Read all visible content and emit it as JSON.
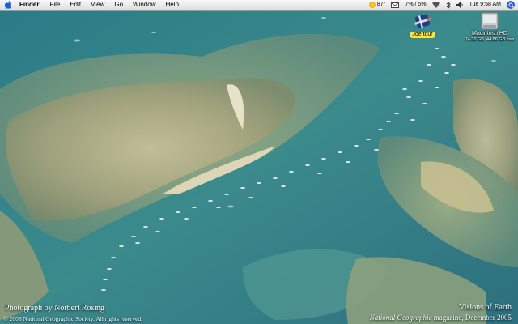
{
  "menubar": {
    "app_name": "Finder",
    "items": [
      "File",
      "Edit",
      "View",
      "Go",
      "Window",
      "Help"
    ],
    "extras": {
      "weather": "87°",
      "battery": "7% / 5%",
      "clock": "Tue 9:58 AM"
    }
  },
  "desktop": {
    "icons": [
      {
        "label": "Joe tour",
        "icon": "airplane-icon"
      },
      {
        "label": "Macintosh HD",
        "sublabel": "74.31 GB, 44.86 GB free",
        "icon": "hard-drive-icon"
      }
    ]
  },
  "wallpaper": {
    "credit_line": "Photograph by Norbert Rosing",
    "copyright": "© 2005 National Geographic Society. All rights reserved.",
    "series_title": "Visions of Earth",
    "magazine_name": "National Geographic",
    "issue": "magazine, December 2005"
  },
  "colors": {
    "water": "#2f7e8c",
    "sandbar": "#b8b48a",
    "menubar_bg": "#eaeaea",
    "selected_label": "#f8e63c",
    "spotlight": "#2d63c8"
  }
}
